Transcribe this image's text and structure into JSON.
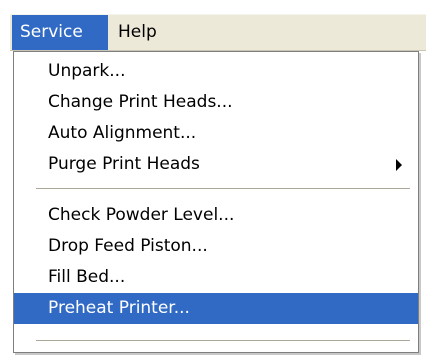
{
  "menubar": {
    "items": [
      {
        "label": "Service"
      },
      {
        "label": "Help"
      }
    ]
  },
  "service_menu": {
    "items": [
      {
        "label": "Unpark..."
      },
      {
        "label": "Change Print Heads..."
      },
      {
        "label": "Auto Alignment..."
      },
      {
        "label": "Purge Print Heads",
        "submenu": true
      },
      {
        "label": "Check Powder Level..."
      },
      {
        "label": "Drop Feed Piston..."
      },
      {
        "label": "Fill Bed..."
      },
      {
        "label": "Preheat Printer...",
        "highlighted": true
      }
    ]
  },
  "colors": {
    "menu_highlight": "#316ac5",
    "menubar_background": "#ece9d8",
    "separator": "#aca899"
  },
  "icons": {
    "submenu_arrow": "triangle-right-icon"
  }
}
